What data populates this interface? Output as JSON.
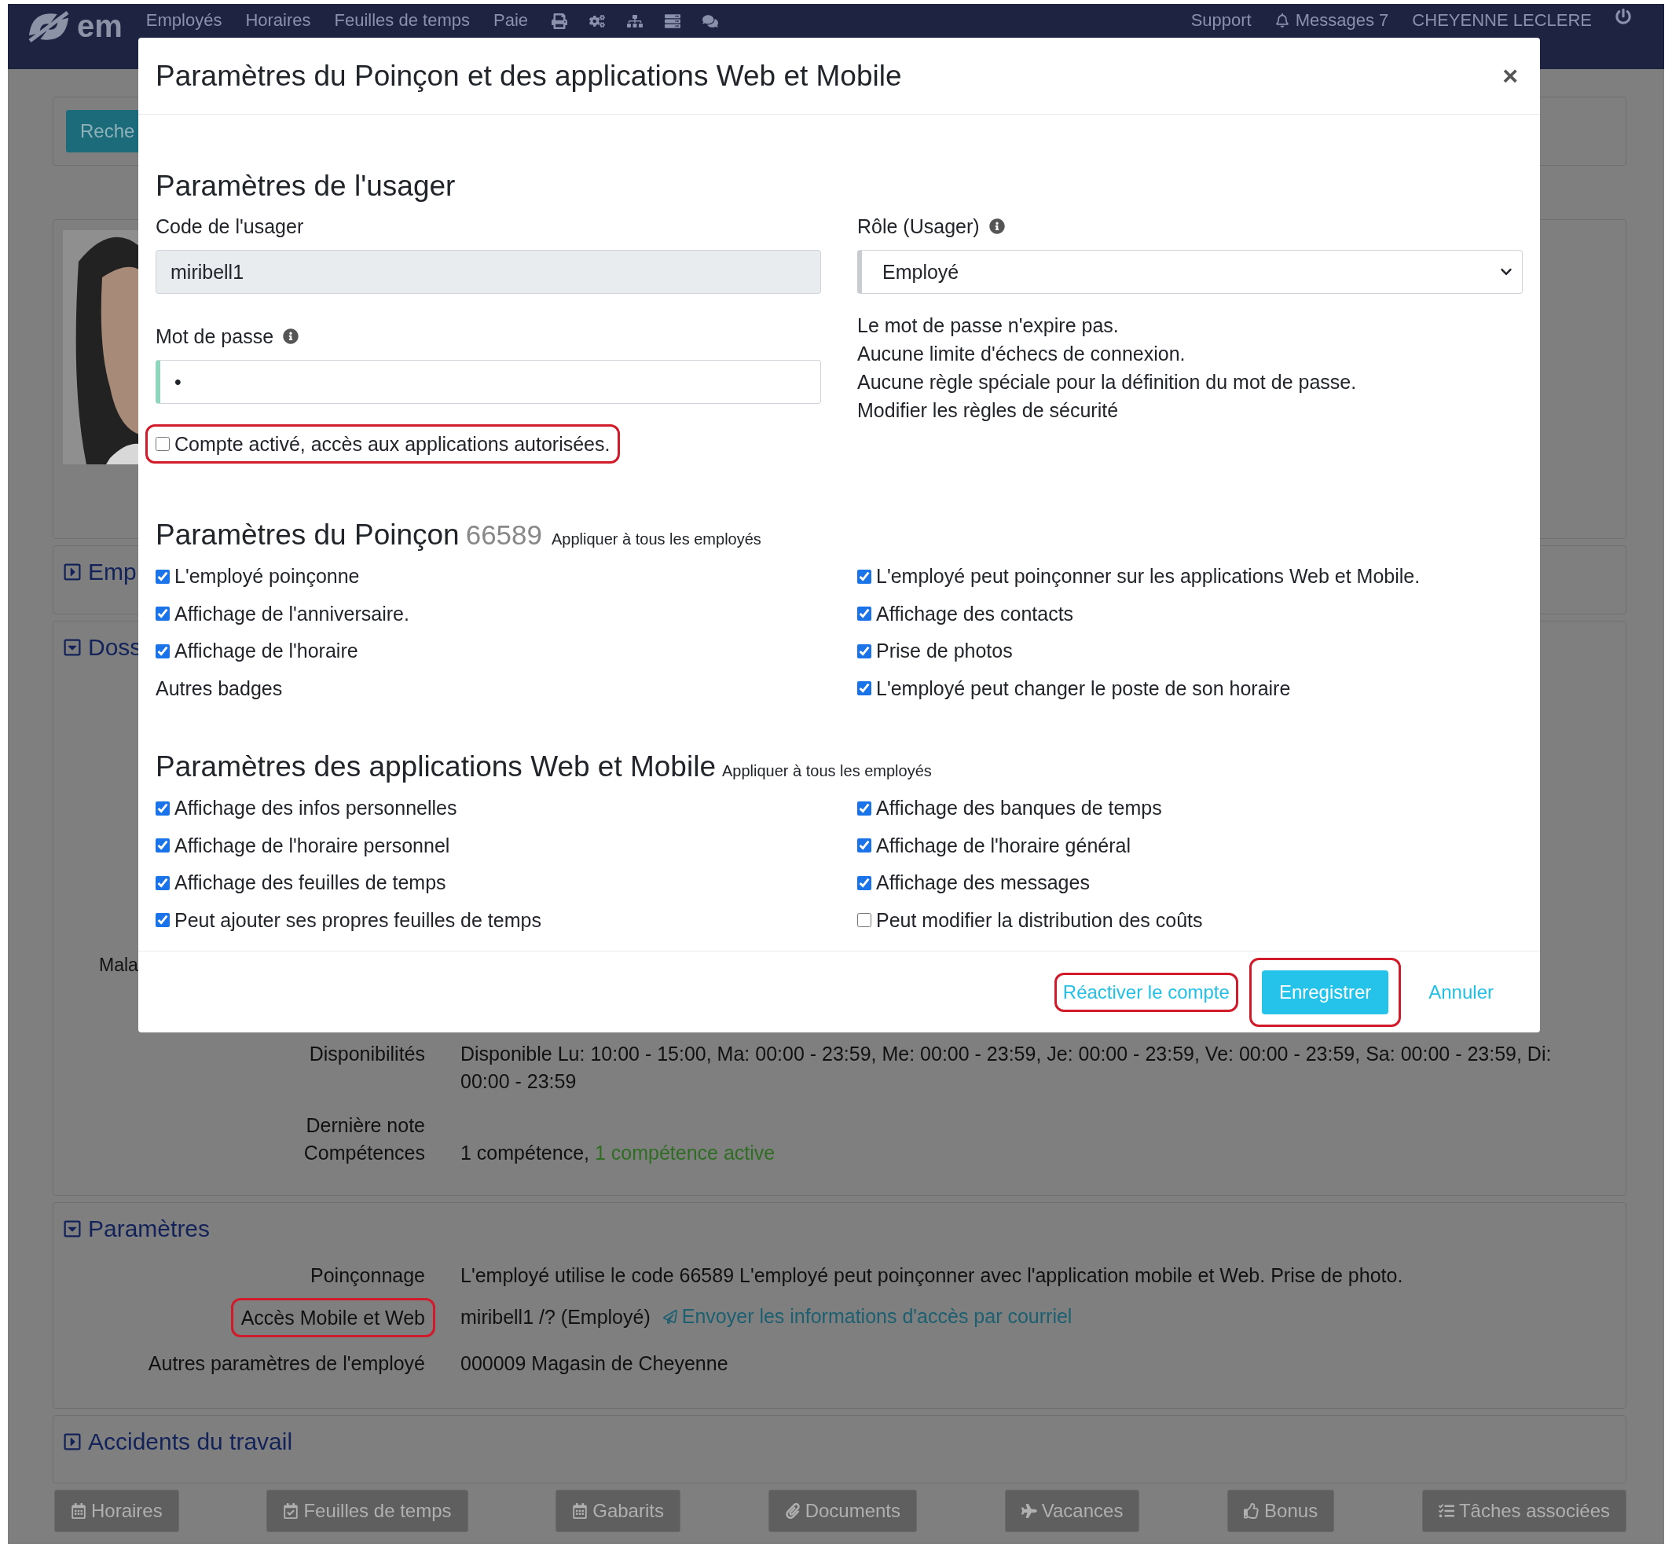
{
  "navbar": {
    "logo_text": "em",
    "items": [
      "Employés",
      "Horaires",
      "Feuilles de temps",
      "Paie"
    ],
    "support": "Support",
    "messages": "Messages 7",
    "user": "CHEYENNE LECLERE"
  },
  "background": {
    "search_button": "Reche",
    "panels": [
      {
        "title": "Emp",
        "expanded": false
      },
      {
        "title": "Doss",
        "expanded": true,
        "cut_label": "Mala",
        "rows": [
          {
            "label": "Disponibilités",
            "value": "Disponible Lu: 10:00 - 15:00, Ma: 00:00 - 23:59, Me: 00:00 - 23:59, Je: 00:00 - 23:59, Ve: 00:00 - 23:59, Sa: 00:00 - 23:59, Di: 00:00 - 23:59"
          },
          {
            "label": "Dernière note"
          },
          {
            "label": "Compétences",
            "value": "1 compétence,",
            "value_active": "1 compétence active"
          }
        ]
      },
      {
        "title": "Paramètres",
        "expanded": true,
        "rows": [
          {
            "label": "Poinçonnage",
            "value": "L'employé utilise le code 66589 L'employé peut poinçonner avec l'application mobile et Web. Prise de photo.",
            "highlighted": false
          },
          {
            "label": "Accès Mobile et Web",
            "value": "miribell1 /? (Employé)",
            "link": "Envoyer les informations d'accès par courriel",
            "highlighted": true
          },
          {
            "label": "Autres paramètres de l'employé",
            "value": "000009 Magasin de Cheyenne",
            "highlighted": false
          }
        ]
      },
      {
        "title": "Accidents du travail",
        "expanded": false
      }
    ],
    "bottom_buttons": [
      "Horaires",
      "Feuilles de temps",
      "Gabarits",
      "Documents",
      "Vacances",
      "Bonus",
      "Tâches associées"
    ]
  },
  "modal": {
    "title": "Paramètres du Poinçon et des applications Web et Mobile",
    "close": "×",
    "user_section": {
      "title": "Paramètres de l'usager",
      "code_label": "Code de l'usager",
      "code_value": "miribell1",
      "role_label": "Rôle (Usager)",
      "role_value": "Employé",
      "password_label": "Mot de passe",
      "password_value": "•",
      "notes": [
        "Le mot de passe n'expire pas.",
        "Aucune limite d'échecs de connexion.",
        "Aucune règle spéciale pour la définition du mot de passe.",
        "Modifier les règles de sécurité"
      ],
      "account_checkbox": {
        "label": "Compte activé, accès aux applications autorisées.",
        "checked": false,
        "highlighted": true
      }
    },
    "sections": [
      {
        "title": "Paramètres du Poinçon",
        "code": "66589",
        "apply": "Appliquer à tous les employés",
        "left": [
          {
            "kind": "checkbox",
            "label": "L'employé poinçonne",
            "checked": true
          },
          {
            "kind": "checkbox",
            "label": "Affichage de l'anniversaire.",
            "checked": true
          },
          {
            "kind": "checkbox",
            "label": "Affichage de l'horaire",
            "checked": true
          },
          {
            "kind": "text",
            "label": "Autres badges"
          }
        ],
        "right": [
          {
            "kind": "checkbox",
            "label": "L'employé peut poinçonner sur les applications Web et Mobile.",
            "checked": true
          },
          {
            "kind": "checkbox",
            "label": "Affichage des contacts",
            "checked": true
          },
          {
            "kind": "checkbox",
            "label": "Prise de photos",
            "checked": true
          },
          {
            "kind": "checkbox",
            "label": "L'employé peut changer le poste de son horaire",
            "checked": true
          }
        ]
      },
      {
        "title": "Paramètres des applications Web et Mobile",
        "apply": "Appliquer à tous les employés",
        "left": [
          {
            "kind": "checkbox",
            "label": "Affichage des infos personnelles",
            "checked": true
          },
          {
            "kind": "checkbox",
            "label": "Affichage de l'horaire personnel",
            "checked": true
          },
          {
            "kind": "checkbox",
            "label": "Affichage des feuilles de temps",
            "checked": true
          },
          {
            "kind": "checkbox",
            "label": "Peut ajouter ses propres feuilles de temps",
            "checked": true
          }
        ],
        "right": [
          {
            "kind": "checkbox",
            "label": "Affichage des banques de temps",
            "checked": true
          },
          {
            "kind": "checkbox",
            "label": "Affichage de l'horaire général",
            "checked": true
          },
          {
            "kind": "checkbox",
            "label": "Affichage des messages",
            "checked": true
          },
          {
            "kind": "checkbox",
            "label": "Peut modifier la distribution des coûts",
            "checked": false
          }
        ]
      }
    ],
    "footer": {
      "reactivate": {
        "label": "Réactiver le compte",
        "highlighted": true
      },
      "save": {
        "label": "Enregistrer",
        "highlighted": true
      },
      "cancel": "Annuler"
    }
  }
}
